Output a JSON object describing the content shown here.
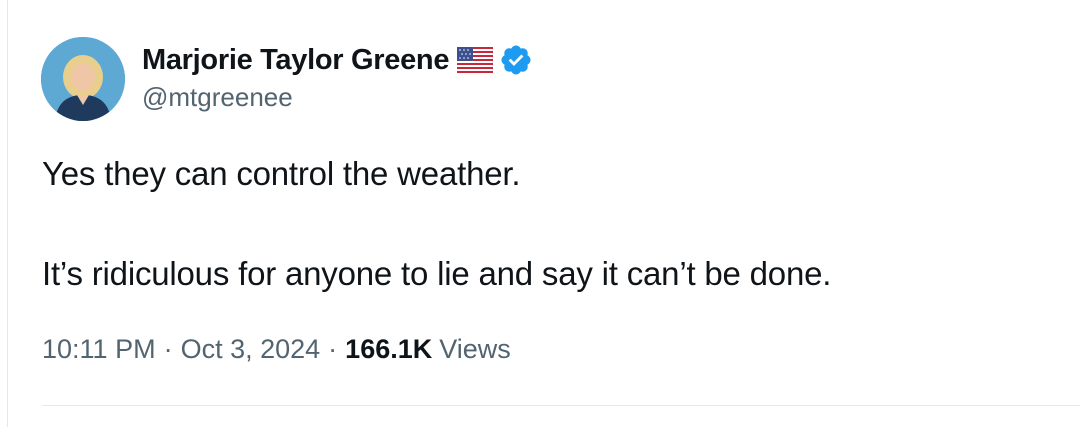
{
  "author": {
    "display_name": "Marjorie Taylor Greene",
    "handle": "@mtgreenee",
    "flag_icon": "us-flag-icon",
    "verified_icon": "verified-badge-icon",
    "verified_color": "#1d9bf0"
  },
  "tweet": {
    "lines": [
      "Yes they can control the weather.",
      "It’s ridiculous for anyone to lie and say it can’t be done."
    ]
  },
  "meta": {
    "time": "10:11 PM",
    "separator": "·",
    "date": "Oct 3, 2024",
    "views_count": "166.1K",
    "views_label": "Views"
  },
  "colors": {
    "text_primary": "#0f1419",
    "text_secondary": "#536471",
    "divider": "#e6e9eb"
  }
}
